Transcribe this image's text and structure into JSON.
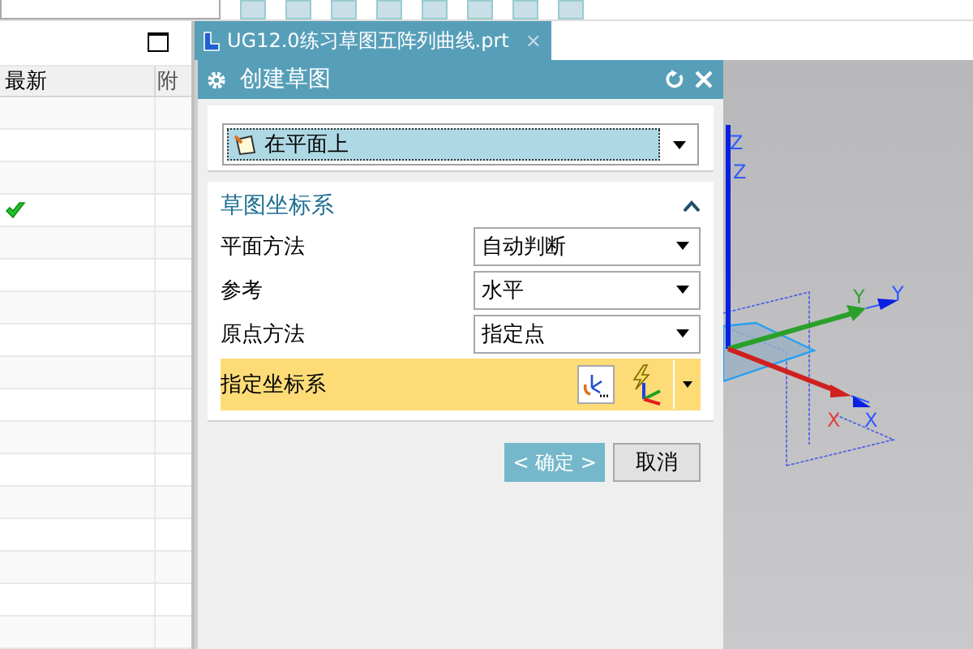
{
  "navigator": {
    "columns": [
      "最新",
      "附"
    ],
    "rows": [
      {
        "checked": false
      },
      {
        "checked": false
      },
      {
        "checked": false
      },
      {
        "checked": true
      },
      {
        "checked": false
      },
      {
        "checked": false
      },
      {
        "checked": false
      },
      {
        "checked": false
      },
      {
        "checked": false
      },
      {
        "checked": false
      },
      {
        "checked": false
      },
      {
        "checked": false
      },
      {
        "checked": false
      },
      {
        "checked": false
      },
      {
        "checked": false
      },
      {
        "checked": false
      },
      {
        "checked": false
      }
    ]
  },
  "document_tab": {
    "title": "UG12.0练习草图五阵列曲线.prt",
    "close": "×"
  },
  "dialog": {
    "title": "创建草图",
    "type_value": "在平面上",
    "section": {
      "title": "草图坐标系",
      "expanded": true,
      "fields": [
        {
          "label": "平面方法",
          "value": "自动判断"
        },
        {
          "label": "参考",
          "value": "水平"
        },
        {
          "label": "原点方法",
          "value": "指定点"
        }
      ],
      "csys_label": "指定坐标系"
    },
    "buttons": [
      {
        "label": "< 确定 >",
        "primary": true
      },
      {
        "label": "取消",
        "primary": false
      }
    ]
  },
  "viewport": {
    "axis_labels": [
      {
        "text": "Z",
        "color": "#2f5bff"
      },
      {
        "text": "Z",
        "color": "#2f5bff"
      },
      {
        "text": "Y",
        "color": "#3aa03a"
      },
      {
        "text": "Y",
        "color": "#2f5bff"
      },
      {
        "text": "X",
        "color": "#e04040"
      },
      {
        "text": "X",
        "color": "#2f5bff"
      }
    ]
  }
}
